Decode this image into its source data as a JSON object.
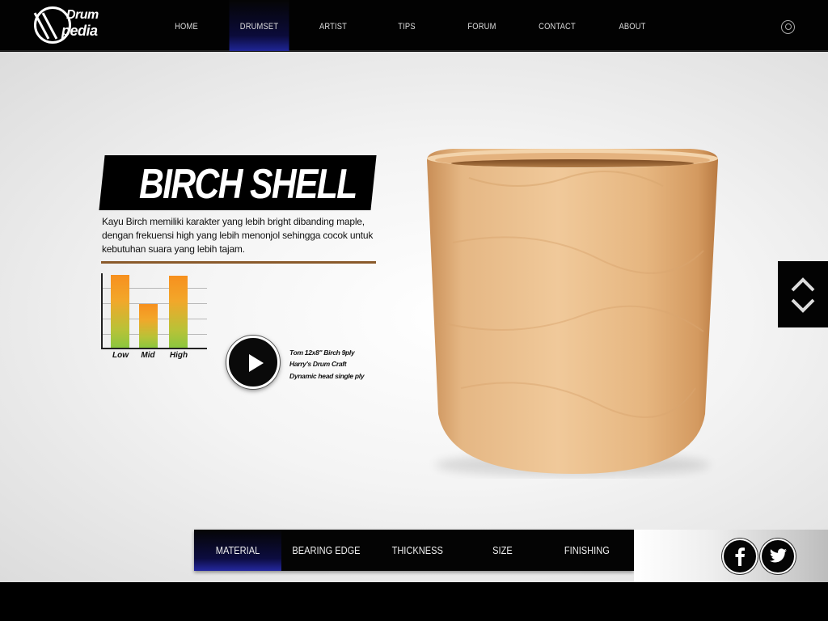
{
  "app": {
    "logo_line1": "Drum",
    "logo_line2": "pedia"
  },
  "nav": {
    "items": [
      {
        "label": "HOME",
        "active": false
      },
      {
        "label": "DRUMSET",
        "active": true
      },
      {
        "label": "ARTIST",
        "active": false
      },
      {
        "label": "TIPS",
        "active": false
      },
      {
        "label": "FORUM",
        "active": false
      },
      {
        "label": "CONTACT",
        "active": false
      },
      {
        "label": "ABOUT",
        "active": false
      }
    ],
    "search_icon": "search-icon"
  },
  "content": {
    "title": "BIRCH SHELL",
    "description": "Kayu Birch memiliki karakter yang lebih bright dibanding maple, dengan frekuensi high yang lebih menonjol sehingga cocok untuk kebutuhan suara yang lebih tajam.",
    "audio": {
      "line1": "Tom 12x8\" Birch 9ply",
      "line2": "Harry's Drum Craft",
      "line3": "Dynamic head single ply"
    }
  },
  "chart_data": {
    "type": "bar",
    "categories": [
      "Low",
      "Mid",
      "High"
    ],
    "values": [
      100,
      60,
      99
    ],
    "ylim": [
      0,
      100
    ],
    "grid": true
  },
  "tabs": [
    {
      "label": "MATERIAL",
      "active": true
    },
    {
      "label": "BEARING EDGE",
      "active": false
    },
    {
      "label": "THICKNESS",
      "active": false
    },
    {
      "label": "SIZE",
      "active": false
    },
    {
      "label": "FINISHING",
      "active": false
    }
  ],
  "social": {
    "facebook_icon": "facebook-icon",
    "twitter_icon": "twitter-icon"
  },
  "colors": {
    "accent": "#2428a0",
    "rule": "#8a5a2b",
    "bar_top": "#f7901e",
    "bar_bottom": "#8cc63f"
  }
}
